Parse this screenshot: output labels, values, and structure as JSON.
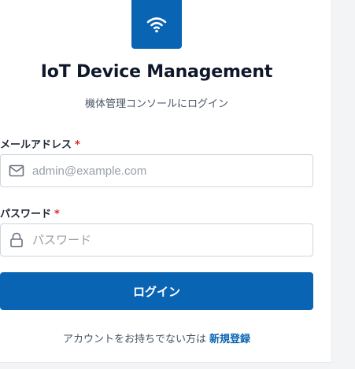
{
  "header": {
    "title": "IoT Device Management",
    "subtitle": "機体管理コンソールにログイン"
  },
  "form": {
    "email": {
      "label": "メールアドレス",
      "required_mark": "*",
      "placeholder": "admin@example.com",
      "value": ""
    },
    "password": {
      "label": "パスワード",
      "required_mark": "*",
      "placeholder": "パスワード",
      "value": ""
    },
    "submit_label": "ログイン"
  },
  "footer": {
    "prompt": "アカウントをお持ちでない方は",
    "signup_link": "新規登録"
  },
  "icons": {
    "logo": "wifi-icon",
    "email": "mail-icon",
    "password": "lock-icon"
  },
  "colors": {
    "brand": "#0a64b4",
    "required": "#dc2626"
  }
}
